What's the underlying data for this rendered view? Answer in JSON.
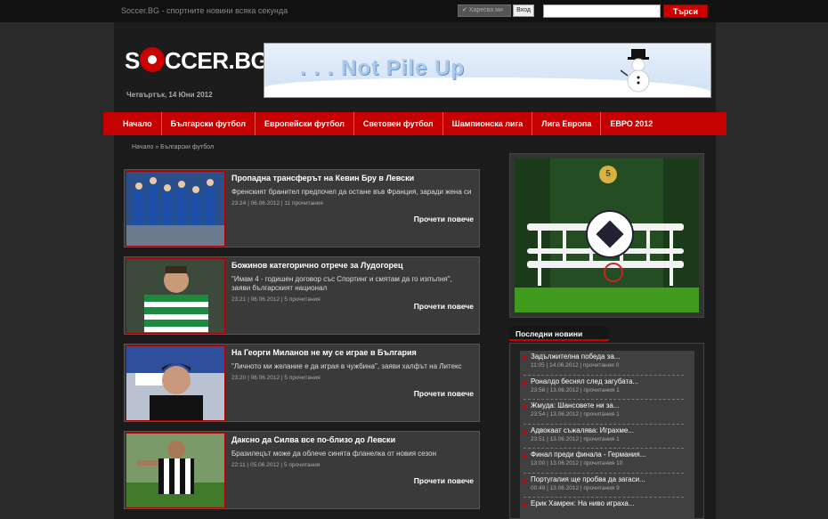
{
  "topbar": {
    "tagline": "Soccer.BG - спортните новини всяка секунда",
    "like_label": "✔ Харесва ми",
    "login_label": "Вход",
    "search_placeholder": "",
    "search_button": "Търси"
  },
  "header": {
    "logo_text": "CCER.BG",
    "logo_prefix": "S",
    "date": "Четвъртък, 14 Юни 2012",
    "banner_text": ". . . Not Pile Up"
  },
  "nav": {
    "items": [
      "Начало",
      "Български футбол",
      "Европейски футбол",
      "Световен футбол",
      "Шампионска лига",
      "Лига Европа",
      "ЕВРО 2012"
    ]
  },
  "breadcrumb": "Начало » Български футбол",
  "articles": [
    {
      "title": "Пропадна трансферът на Кевин Бру в Левски",
      "desc": "Френският бранител предпочел да остане във Франция, заради жена си",
      "meta": "23:24 | 06.06.2012 | 11 прочитания",
      "more": "Прочети повече"
    },
    {
      "title": "Божинов категорично отрече за Лудогорец",
      "desc": "\"Имам 4 - годишен договор със Спортинг и смятам да го изпълня\", заяви българският национал",
      "meta": "23:21 | 06.06.2012 | 5 прочитания",
      "more": "Прочети повече"
    },
    {
      "title": "На Георги Миланов не му се играе в България",
      "desc": "\"Личното ми желание е да играя в чужбина\", заяви халфът на Литекс",
      "meta": "23:20 | 06.06.2012 | 5 прочитания",
      "more": "Прочети повече"
    },
    {
      "title": "Даксно да Силва все по-близо до Левски",
      "desc": "Бразилецът може да облече синята фланелка от новия сезон",
      "meta": "22:11 | 05.06.2012 | 5 прочитания",
      "more": "Прочети повече"
    }
  ],
  "sidebar": {
    "game_coin": "5",
    "latest_title": "Последни новини",
    "latest": [
      {
        "title": "Задължителна победа за...",
        "meta": "11:05 | 14.06.2012 | прочитания 0"
      },
      {
        "title": "Роналдо беснял след загубата...",
        "meta": "23:56 | 13.06.2012 | прочитания 1"
      },
      {
        "title": "Жмуда: Шансовете ни за...",
        "meta": "23:54 | 13.06.2012 | прочитания 1"
      },
      {
        "title": "Адвокаат съжалява: Играхме...",
        "meta": "23:51 | 13.06.2012 | прочитания 1"
      },
      {
        "title": "Финал преди финала - Германия...",
        "meta": "13:00 | 13.06.2012 | прочитания 10"
      },
      {
        "title": "Португалия ще пробва да загаси...",
        "meta": "00:49 | 13.06.2012 | прочитания 9"
      },
      {
        "title": "Ерик Хамрен: На ниво играха...",
        "meta": ""
      }
    ]
  }
}
